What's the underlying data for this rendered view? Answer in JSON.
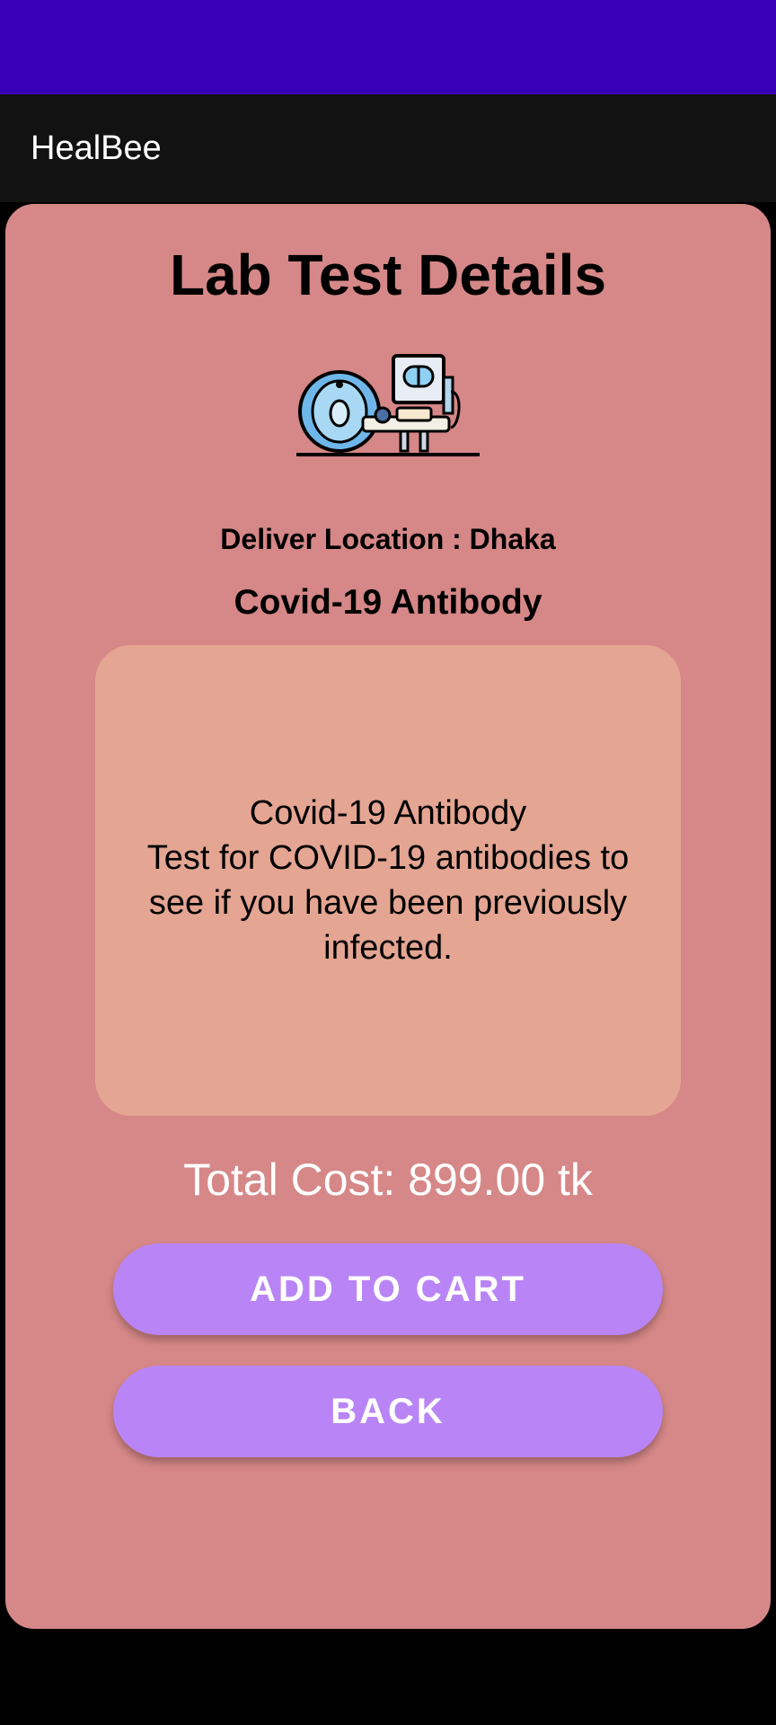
{
  "app": {
    "title": "HealBee"
  },
  "page": {
    "title": "Lab Test Details",
    "illustration_icon": "mri-scanner-icon",
    "location": "Deliver Location : Dhaka",
    "test_name": "Covid-19 Antibody"
  },
  "description": {
    "lines": [
      "Covid-19 Antibody",
      "Test for COVID-19 antibodies to",
      "see if you have been previously",
      "infected."
    ]
  },
  "total_cost": "Total Cost: 899.00 tk",
  "buttons": {
    "add_to_cart": "ADD TO CART",
    "back": "BACK"
  },
  "colors": {
    "status_bar": "#3a00b8",
    "app_bar": "#121212",
    "card": "#d68787",
    "desc_box": "#e4a592",
    "button": "#b985f6"
  }
}
